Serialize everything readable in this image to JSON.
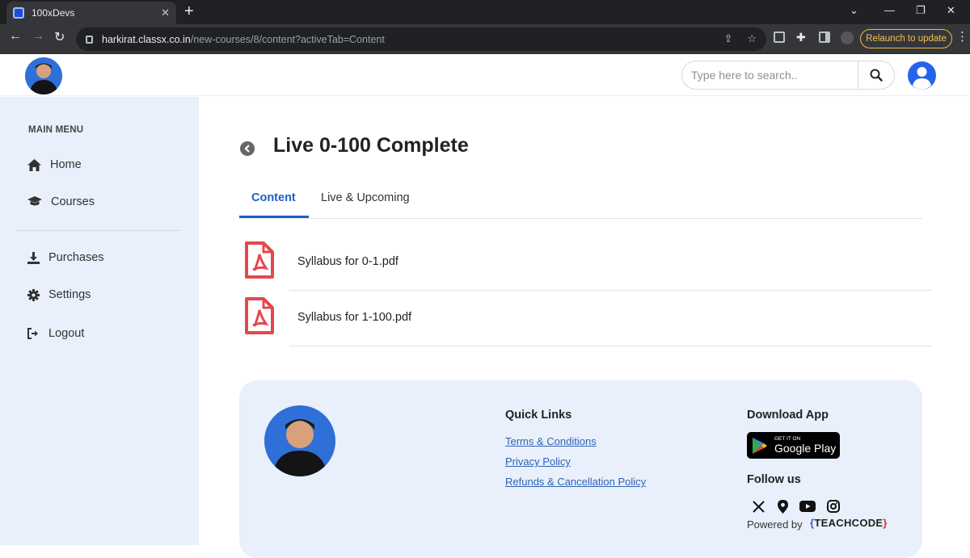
{
  "browser": {
    "tab_title": "100xDevs",
    "url_host": "harkirat.classx.co.in",
    "url_path": "/new-courses/8/content?activeTab=Content",
    "relaunch_label": "Relaunch to update"
  },
  "header": {
    "search_placeholder": "Type here to search.."
  },
  "sidebar": {
    "title": "MAIN MENU",
    "items": [
      {
        "label": "Home",
        "icon": "home-icon"
      },
      {
        "label": "Courses",
        "icon": "graduation-cap-icon"
      },
      {
        "label": "Purchases",
        "icon": "download-icon"
      },
      {
        "label": "Settings",
        "icon": "gear-icon"
      },
      {
        "label": "Logout",
        "icon": "logout-icon"
      }
    ]
  },
  "main": {
    "title": "Live 0-100 Complete",
    "tabs": [
      {
        "label": "Content",
        "active": true
      },
      {
        "label": "Live & Upcoming",
        "active": false
      }
    ],
    "files": [
      {
        "name": "Syllabus for 0-1.pdf",
        "icon": "pdf-icon"
      },
      {
        "name": "Syllabus for 1-100.pdf",
        "icon": "pdf-icon"
      }
    ]
  },
  "footer": {
    "quick_links_title": "Quick Links",
    "links": [
      "Terms & Conditions",
      "Privacy Policy",
      "Refunds & Cancellation Policy"
    ],
    "download_title": "Download App",
    "gplay_small": "GET IT ON",
    "gplay_big": "Google Play",
    "follow_title": "Follow us",
    "social": [
      "x-icon",
      "location-pin-icon",
      "youtube-icon",
      "instagram-icon"
    ],
    "powered_by": "Powered by",
    "brand": "TEACHCODE"
  },
  "colors": {
    "accent": "#1f5fc4",
    "sidebar_bg": "#e9f0fb",
    "pdf_red": "#e5484d",
    "user_avatar": "#2563eb"
  }
}
